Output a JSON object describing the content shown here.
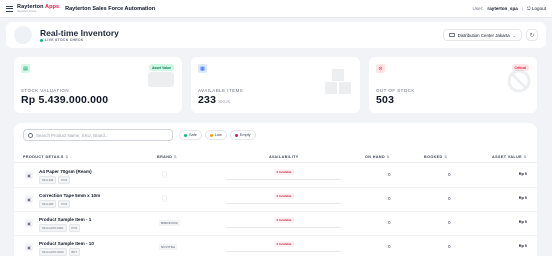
{
  "topbar": {
    "brand_main": "Rayterton ",
    "brand_accent": "Apps",
    "brand_sub": "Rayterton Group",
    "app_title": "Rayterton Sales Force Automation",
    "user_label": "User:",
    "user_name": "rayterton_spa",
    "separator": "|",
    "logout_label": "Logout"
  },
  "header": {
    "title": "Real-time Inventory",
    "subtitle": "LIVE STOCK CHECK",
    "distribution_center": "Distribution Center Jakarta",
    "refresh_icon": "↻"
  },
  "stats": [
    {
      "label": "STOCK VALUATION",
      "value": "Rp 5.439.000.000",
      "unit": "",
      "badge": "Asset Value",
      "icon": "money-icon",
      "accent": "#10b981",
      "tint": "#d1fae5"
    },
    {
      "label": "AVAILABLE ITEMS",
      "value": "233",
      "unit": "SKUs",
      "badge": "",
      "icon": "box-icon",
      "accent": "#3b82f6",
      "tint": "#dbeafe"
    },
    {
      "label": "OUT OF STOCK",
      "value": "503",
      "unit": "",
      "badge": "Critical",
      "icon": "ban-icon",
      "accent": "#e11d48",
      "tint": "#ffe4e6"
    }
  ],
  "table": {
    "search_placeholder": "Search Product Name, SKU, Brand...",
    "legend": [
      {
        "label": "Safe",
        "color": "#10b981"
      },
      {
        "label": "Low",
        "color": "#f59e0b"
      },
      {
        "label": "Empty",
        "color": "#e11d48"
      }
    ],
    "columns": {
      "product": "PRODUCT DETAILS",
      "brand": "BRAND",
      "availability": "AVAILABILITY",
      "on_hand": "ON HAND",
      "booked": "BOOKED",
      "asset_value": "ASSET VALUE"
    },
    "sort_glyph": "⇅",
    "rows": [
      {
        "name": "A4 Paper 70gsm (Ream)",
        "sku": "SKU-184",
        "uom": "PCS",
        "brand": "",
        "availability": "0 Available",
        "availability_pct": 0,
        "on_hand": "0",
        "booked": "0",
        "asset_value": "Rp 0"
      },
      {
        "name": "Correction Tape 5mm x 10m",
        "sku": "SKU-180",
        "uom": "PCS",
        "brand": "",
        "availability": "0 Available",
        "availability_pct": 0,
        "on_hand": "0",
        "booked": "0",
        "asset_value": "Rp 0"
      },
      {
        "name": "Product Sample Item - 1",
        "sku": "SKU-GATO-9001",
        "uom": "PCS",
        "brand": "BIRDFOOD",
        "availability": "0 Available",
        "availability_pct": 0,
        "on_hand": "0",
        "booked": "0",
        "asset_value": "Rp 0"
      },
      {
        "name": "Product Sample Item - 10",
        "sku": "SKU-GATO-9010",
        "uom": "BKT",
        "brand": "NOVITRA",
        "availability": "0 Available",
        "availability_pct": 0,
        "on_hand": "0",
        "booked": "0",
        "asset_value": "Rp 0"
      }
    ]
  }
}
